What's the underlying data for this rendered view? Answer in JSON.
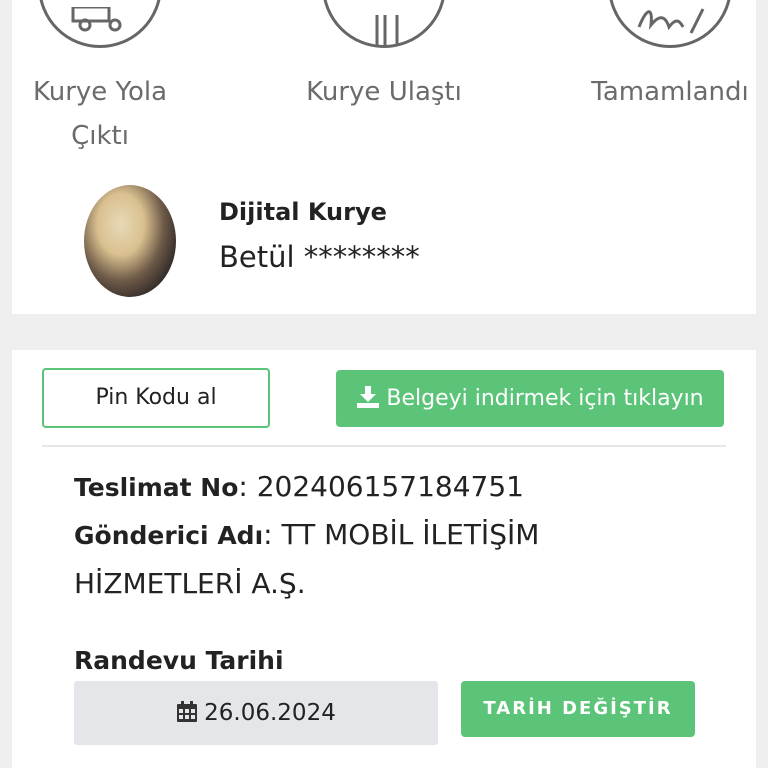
{
  "steps": [
    {
      "label_line1": "Kurye Yola",
      "label_line2": "Çıktı",
      "icon": "truck-icon"
    },
    {
      "label_line1": "Kurye Ulaştı",
      "icon": "cutlery-icon"
    },
    {
      "label_line1": "Tamamlandı",
      "icon": "signature-icon"
    }
  ],
  "courier": {
    "title": "Dijital Kurye",
    "name": "Betül ********"
  },
  "actions": {
    "pin_label": "Pin Kodu al",
    "download_label": "Belgeyi indirmek için tıklayın"
  },
  "delivery": {
    "tracking_label": "Teslimat No",
    "tracking_value": "202406157184751",
    "sender_label": "Gönderici Adı",
    "sender_value_line1": "TT MOBİL İLETİŞİM",
    "sender_value_line2": "HİZMETLERİ A.Ş.",
    "appointment_label": "Randevu Tarihi",
    "appointment_date": "26.06.2024",
    "change_date_label": "TARİH DEĞİŞTİR"
  },
  "colors": {
    "accent": "#5cc478",
    "step_border": "#666666",
    "date_bg": "#e4e6e9"
  }
}
